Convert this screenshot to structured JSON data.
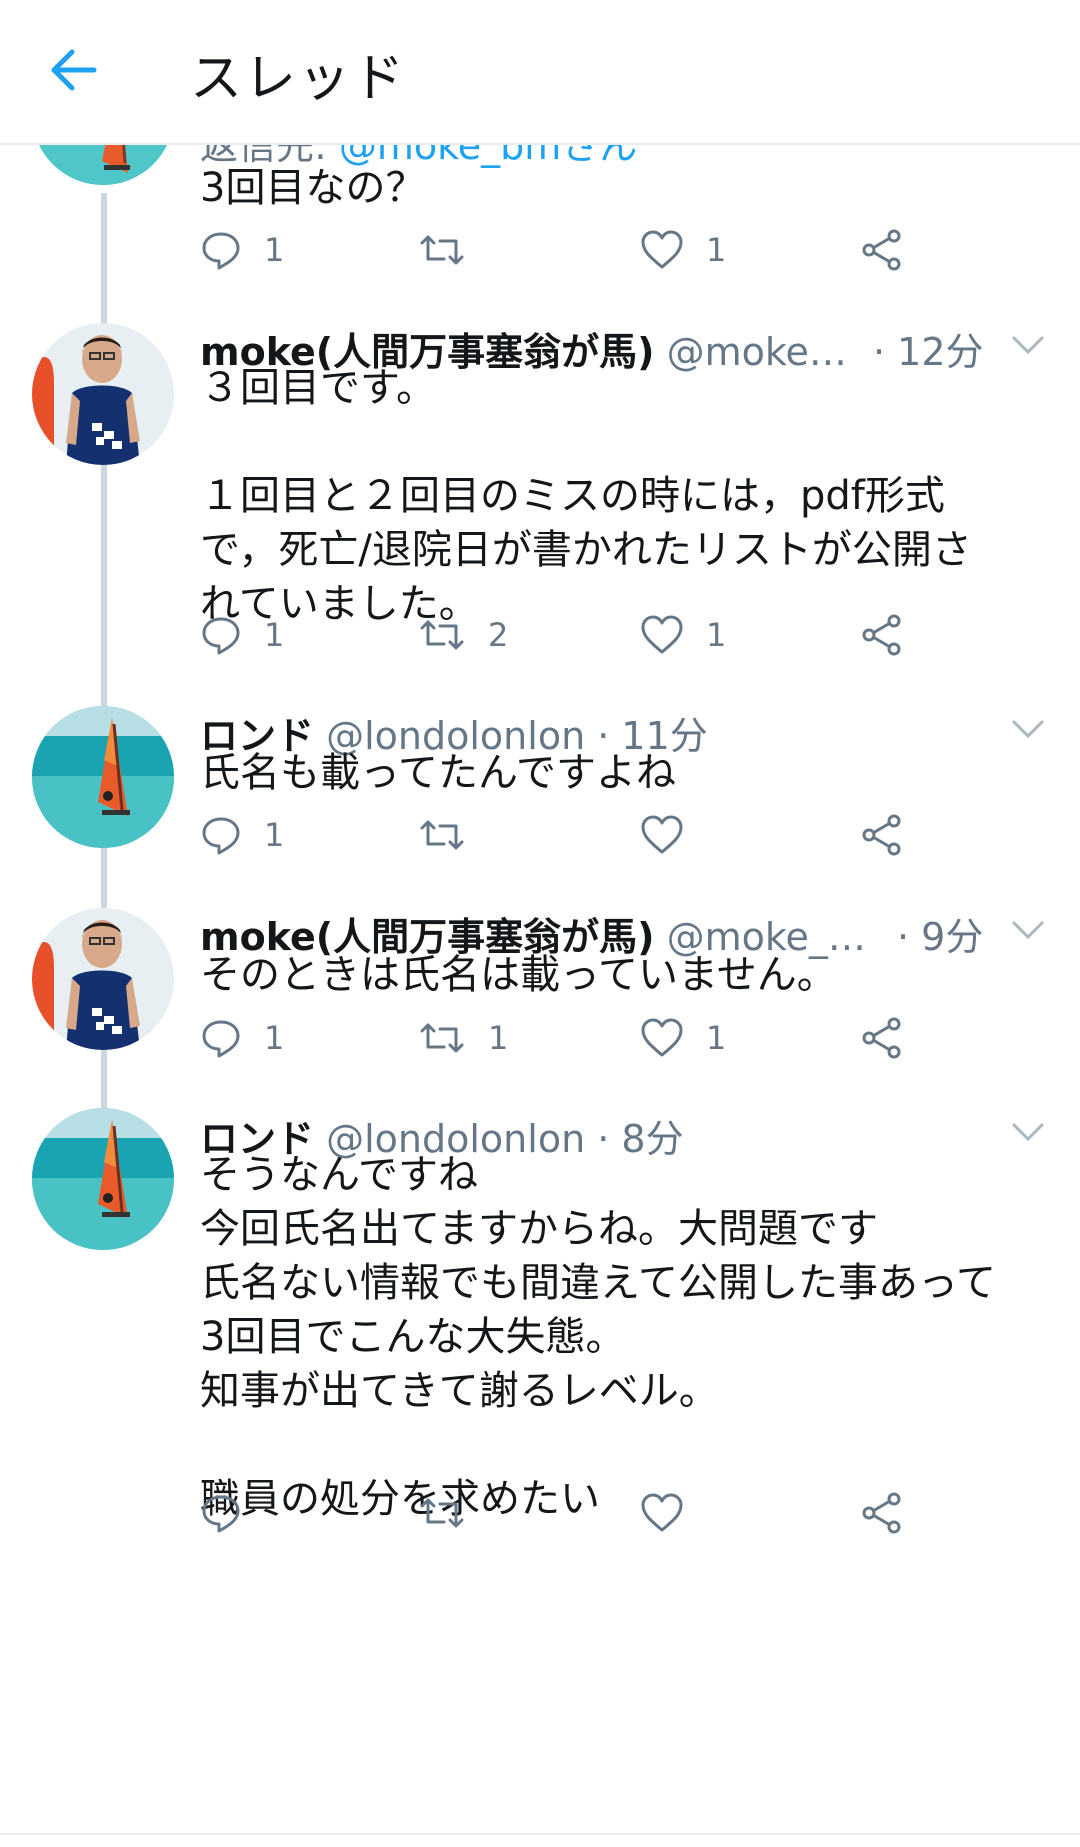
{
  "header": {
    "title": "スレッド"
  },
  "tweets": [
    {
      "reply_prefix": "返信先: ",
      "reply_mention": "@moke_bmさん",
      "text": "3回目なの？",
      "counts": {
        "reply": "1",
        "retweet": "",
        "like": "1"
      }
    },
    {
      "name": "moke(人間万事塞翁が馬)",
      "handle": "@moke…",
      "time": "· 12分",
      "text": "３回目です。\n\n１回目と２回目のミスの時には，pdf形式\nで，死亡/退院日が書かれたリストが公開さ\nれていました。",
      "counts": {
        "reply": "1",
        "retweet": "2",
        "like": "1"
      }
    },
    {
      "name": "ロンド",
      "handle": "@londolonlon",
      "time": "· 11分",
      "text": "氏名も載ってたんですよね",
      "counts": {
        "reply": "1",
        "retweet": "",
        "like": ""
      }
    },
    {
      "name": "moke(人間万事塞翁が馬)",
      "handle": "@moke_…",
      "time": "· 9分",
      "text": "そのときは氏名は載っていません。",
      "counts": {
        "reply": "1",
        "retweet": "1",
        "like": "1"
      }
    },
    {
      "name": "ロンド",
      "handle": "@londolonlon",
      "time": "· 8分",
      "text": "そうなんですね\n今回氏名出てますからね。大問題です\n氏名ない情報でも間違えて公開した事あって\n3回目でこんな大失態。\n知事が出てきて謝るレベル。\n\n職員の処分を求めたい",
      "counts": {
        "reply": "",
        "retweet": "",
        "like": ""
      }
    }
  ],
  "icons": {
    "back": "arrow-left-icon",
    "reply": "speech-bubble-icon",
    "retweet": "retweet-icon",
    "like": "heart-icon",
    "share": "share-icon",
    "more": "chevron-down-icon"
  },
  "colors": {
    "accent": "#1da1f2",
    "secondary_text": "#657786",
    "primary_text": "#14171a",
    "divider": "#e6ecf0"
  }
}
